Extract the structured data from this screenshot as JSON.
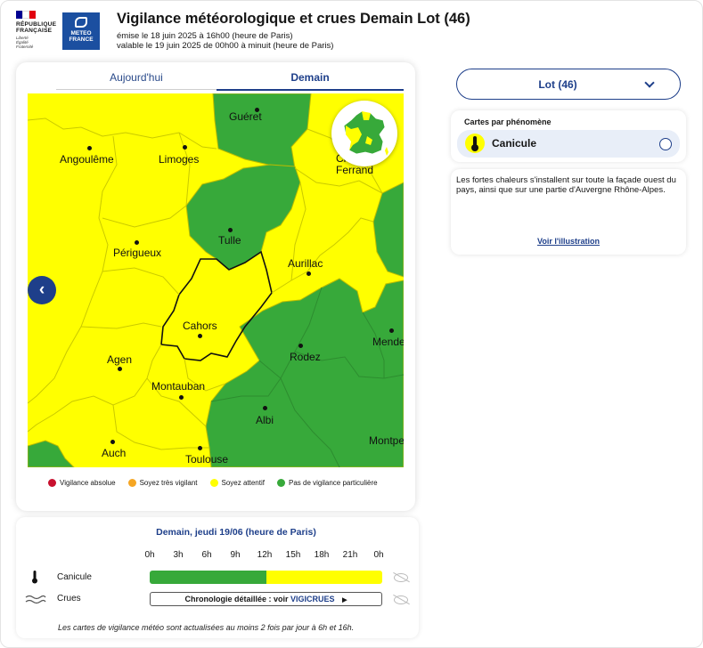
{
  "header": {
    "rf_lines": [
      "RÉPUBLIQUE",
      "FRANÇAISE"
    ],
    "motto": [
      "Liberté",
      "Égalité",
      "Fraternité"
    ],
    "logo_text": [
      "METEO",
      "FRANCE"
    ],
    "title": "Vigilance météorologique et crues Demain Lot (46)",
    "issued": "émise le 18 juin 2025 à 16h00 (heure de Paris)",
    "valid": "valable le 19 juin 2025 de 00h00 à minuit (heure de Paris)"
  },
  "tabs": {
    "today": "Aujourd'hui",
    "tomorrow": "Demain"
  },
  "map": {
    "cities": [
      {
        "name": "Guéret"
      },
      {
        "name": "Angoulême"
      },
      {
        "name": "Limoges"
      },
      {
        "name": "Clermont-"
      },
      {
        "name": "Ferrand"
      },
      {
        "name": "Tulle"
      },
      {
        "name": "Périgueux"
      },
      {
        "name": "Aurillac"
      },
      {
        "name": "Cahors"
      },
      {
        "name": "Mende"
      },
      {
        "name": "Agen"
      },
      {
        "name": "Rodez"
      },
      {
        "name": "Montauban"
      },
      {
        "name": "Albi"
      },
      {
        "name": "Auch"
      },
      {
        "name": "Toulouse"
      },
      {
        "name": "Montpe"
      }
    ],
    "colors": {
      "yellow": "#ffff00",
      "green": "#37a93a",
      "orange": "#f5a623",
      "red": "#d0021b"
    }
  },
  "legend": [
    {
      "label": "Vigilance absolue",
      "color": "#c8102e"
    },
    {
      "label": "Soyez très vigilant",
      "color": "#f5a623"
    },
    {
      "label": "Soyez attentif",
      "color": "#ffff00"
    },
    {
      "label": "Pas de vigilance particulière",
      "color": "#37a93a"
    }
  ],
  "department": {
    "selected": "Lot (46)"
  },
  "phenomena": {
    "heading": "Cartes par phénomène",
    "selected": "Canicule",
    "icon": "thermometer-icon"
  },
  "description": {
    "text": "Les fortes chaleurs s'installent sur toute la façade ouest du pays, ainsi que sur une partie d'Auvergne Rhône-Alpes.",
    "link": "Voir l'illustration"
  },
  "timeline": {
    "title": "Demain, jeudi 19/06 (heure de Paris)",
    "hours": [
      "0h",
      "3h",
      "6h",
      "9h",
      "12h",
      "15h",
      "18h",
      "21h",
      "0h"
    ],
    "rows": [
      {
        "label": "Canicule",
        "segments": [
          {
            "level": "green",
            "until_hour": 12
          },
          {
            "level": "yellow",
            "until_hour": 24
          }
        ]
      },
      {
        "label": "Crues",
        "button_prefix": "Chronologie détaillée : voir",
        "button_brand": "VIGICRUES"
      }
    ]
  },
  "footnote": "Les cartes de vigilance météo sont actualisées au moins 2 fois par jour à 6h et 16h."
}
